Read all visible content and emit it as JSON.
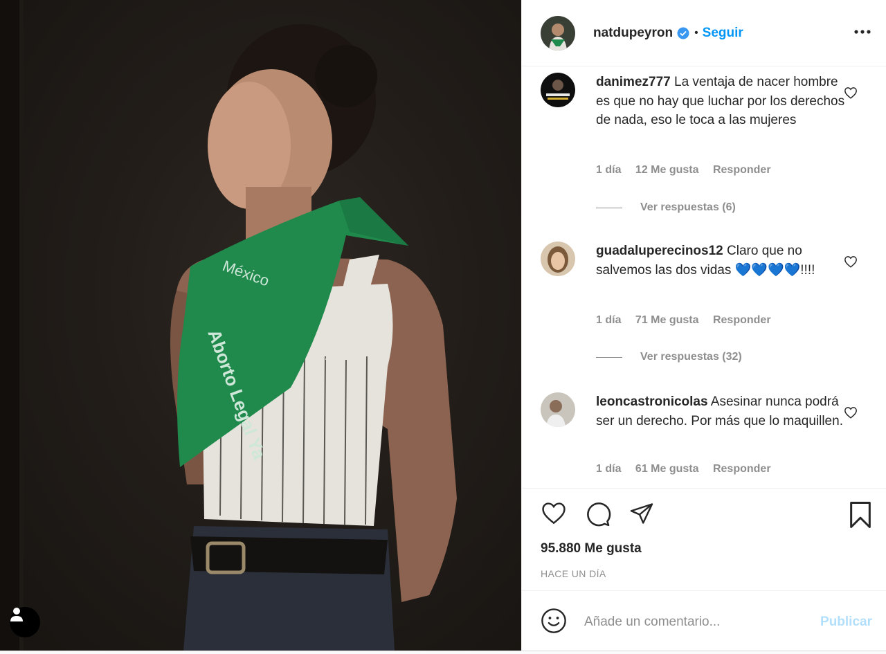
{
  "post": {
    "author": "natdupeyron",
    "verified": true,
    "separator": "•",
    "follow_label": "Seguir",
    "more_icon": "more-horizontal-icon",
    "likes_text": "95.880 Me gusta",
    "time_ago": "HACE UN DÍA"
  },
  "comments": [
    {
      "user": "danimez777",
      "text": "La ventaja de nacer hombre es que no hay que luchar por los derechos de nada, eso le toca a las mujeres",
      "age": "1 día",
      "likes": "12 Me gusta",
      "reply_label": "Responder",
      "view_replies": "Ver respuestas (6)"
    },
    {
      "user": "guadaluperecinos12",
      "text": "Claro que no salvemos las dos vidas 💙💙💙💙!!!!",
      "age": "1 día",
      "likes": "71 Me gusta",
      "reply_label": "Responder",
      "view_replies": "Ver respuestas (32)"
    },
    {
      "user": "leoncastronicolas",
      "text": "Asesinar nunca podrá ser un derecho. Por más que lo maquillen.",
      "age": "1 día",
      "likes": "61 Me gusta",
      "reply_label": "Responder"
    }
  ],
  "composer": {
    "placeholder": "Añade un comentario...",
    "publish_label": "Publicar",
    "emoji_icon": "smiley-icon"
  },
  "photo": {
    "bandana_text": "Aborto Legal Ya",
    "bandana_text2": "México",
    "user_tag_icon": "person-icon"
  },
  "colors": {
    "accent": "#0095f6",
    "publish_disabled": "#b2dffc",
    "bandana": "#1f8a4c",
    "heart_blue": "#1877f2"
  }
}
